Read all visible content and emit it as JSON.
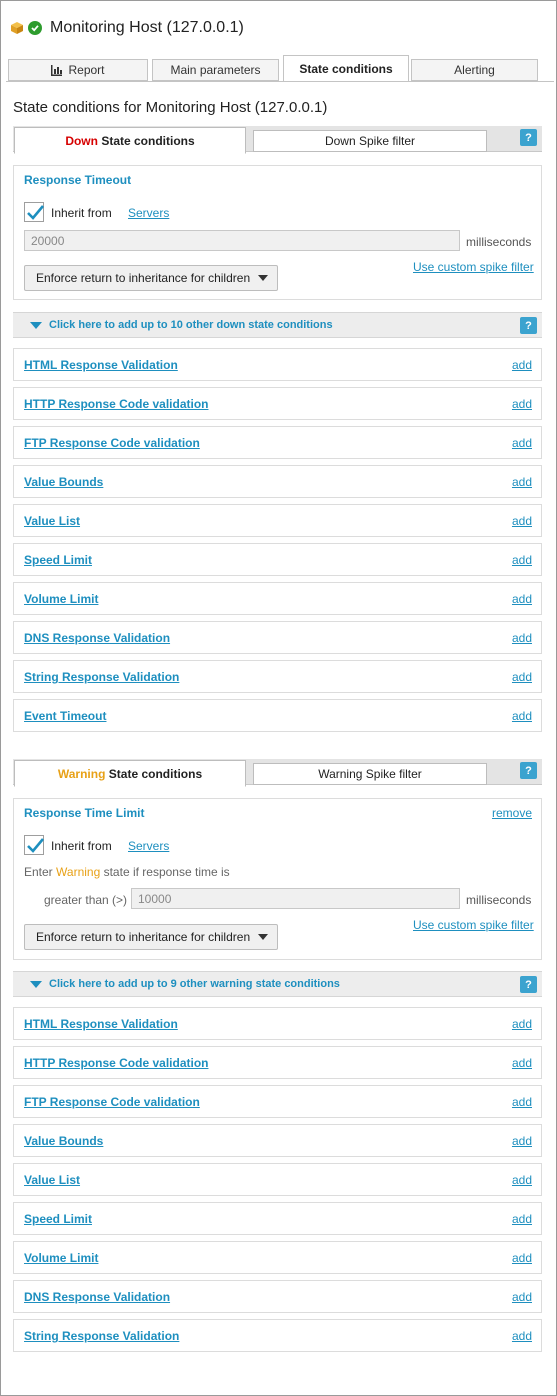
{
  "header": {
    "title": "Monitoring Host (127.0.0.1)",
    "icon": "box-icon",
    "status_icon": "check-circle-icon",
    "status_color": "#2e9c2e"
  },
  "tabs": [
    {
      "label": "Report",
      "icon": "bar-chart-icon"
    },
    {
      "label": "Main parameters"
    },
    {
      "label": "State conditions",
      "active": true
    },
    {
      "label": "Alerting"
    }
  ],
  "section_title": "State conditions for Monitoring Host (127.0.0.1)",
  "down": {
    "tab_state": "Down",
    "tab_suffix": " State conditions",
    "spike_tab": "Down Spike filter",
    "help": "?",
    "panel": {
      "title": "Response Timeout",
      "inherit_checked": true,
      "inherit_label": "Inherit from",
      "inherit_link": "Servers",
      "input_value": "20000",
      "unit": "milliseconds",
      "spike_link": "Use custom spike filter",
      "enforce_label": "Enforce return to inheritance for children"
    },
    "add_bar": "Click here to add up to 10 other down state conditions",
    "conditions": [
      {
        "name": "HTML Response Validation",
        "action": "add"
      },
      {
        "name": "HTTP Response Code validation",
        "action": "add"
      },
      {
        "name": "FTP Response Code validation",
        "action": "add"
      },
      {
        "name": "Value Bounds",
        "action": "add"
      },
      {
        "name": "Value List",
        "action": "add"
      },
      {
        "name": "Speed Limit",
        "action": "add"
      },
      {
        "name": "Volume Limit",
        "action": "add"
      },
      {
        "name": "DNS Response Validation",
        "action": "add"
      },
      {
        "name": "String Response Validation",
        "action": "add"
      },
      {
        "name": "Event Timeout",
        "action": "add"
      }
    ]
  },
  "warning": {
    "tab_state": "Warning",
    "tab_suffix": " State conditions",
    "spike_tab": "Warning Spike filter",
    "help": "?",
    "panel": {
      "title": "Response Time Limit",
      "remove": "remove",
      "inherit_checked": true,
      "inherit_label": "Inherit from",
      "inherit_link": "Servers",
      "enter_prefix": "Enter ",
      "enter_state": "Warning",
      "enter_suffix": " state if response time is",
      "compare_label": "greater than (>)",
      "input_value": "10000",
      "unit": "milliseconds",
      "spike_link": "Use custom spike filter",
      "enforce_label": "Enforce return to inheritance for children"
    },
    "add_bar": "Click here to add up to 9 other warning state conditions",
    "conditions": [
      {
        "name": "HTML Response Validation",
        "action": "add"
      },
      {
        "name": "HTTP Response Code validation",
        "action": "add"
      },
      {
        "name": "FTP Response Code validation",
        "action": "add"
      },
      {
        "name": "Value Bounds",
        "action": "add"
      },
      {
        "name": "Value List",
        "action": "add"
      },
      {
        "name": "Speed Limit",
        "action": "add"
      },
      {
        "name": "Volume Limit",
        "action": "add"
      },
      {
        "name": "DNS Response Validation",
        "action": "add"
      },
      {
        "name": "String Response Validation",
        "action": "add"
      }
    ]
  },
  "colors": {
    "accent": "#1e8fbf",
    "down": "#d60000",
    "warning": "#e8a117"
  }
}
